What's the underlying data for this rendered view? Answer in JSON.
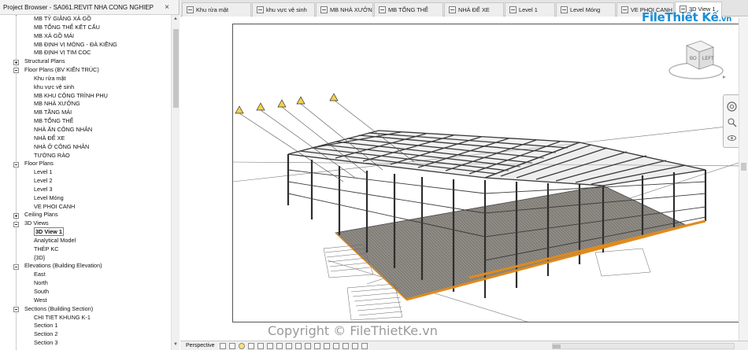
{
  "browser": {
    "title": "Project Browser - SA061.REVIT NHA CONG NGHIEP",
    "close": "×",
    "rows": [
      {
        "label": "MB TỶ GIẰNG XÀ GỒ",
        "level": 2
      },
      {
        "label": "MB TỔNG THỂ KẾT CẤU",
        "level": 2
      },
      {
        "label": "MB XÀ GỒ MÁI",
        "level": 2
      },
      {
        "label": "MB ĐỊNH VỊ MÓNG - ĐÀ KIỀNG",
        "level": 2
      },
      {
        "label": "MB ĐỊNH VỊ TIM COC",
        "level": 2
      },
      {
        "label": "Structural Plans",
        "level": 1,
        "toggle": "plus"
      },
      {
        "label": "Floor Plans (BV KIẾN TRÚC)",
        "level": 1,
        "toggle": "minus"
      },
      {
        "label": "Khu rửa mặt",
        "level": 2
      },
      {
        "label": "khu vực vệ sinh",
        "level": 2
      },
      {
        "label": "MB KHU CÔNG TRÌNH PHỤ",
        "level": 2
      },
      {
        "label": "MB NHÀ XƯỞNG",
        "level": 2
      },
      {
        "label": "MB TẦNG MÁI",
        "level": 2
      },
      {
        "label": "MB TỔNG THỂ",
        "level": 2
      },
      {
        "label": "NHÀ ĂN CÔNG NHÂN",
        "level": 2
      },
      {
        "label": "NHÀ ĐỂ XE",
        "level": 2
      },
      {
        "label": "NHÀ Ở CÔNG NHÂN",
        "level": 2
      },
      {
        "label": "TƯỜNG RÀO",
        "level": 2
      },
      {
        "label": "Floor Plans",
        "level": 1,
        "toggle": "minus"
      },
      {
        "label": "Level 1",
        "level": 2
      },
      {
        "label": "Level 2",
        "level": 2
      },
      {
        "label": "Level 3",
        "level": 2
      },
      {
        "label": "Level Móng",
        "level": 2
      },
      {
        "label": "VE PHOI CANH",
        "level": 2
      },
      {
        "label": "Ceiling Plans",
        "level": 1,
        "toggle": "plus"
      },
      {
        "label": "3D Views",
        "level": 1,
        "toggle": "minus"
      },
      {
        "label": "3D View 1",
        "level": 2,
        "selected": true
      },
      {
        "label": "Analytical Model",
        "level": 2
      },
      {
        "label": "THÉP KC",
        "level": 2
      },
      {
        "label": "{3D}",
        "level": 2
      },
      {
        "label": "Elevations (Building Elevation)",
        "level": 1,
        "toggle": "minus"
      },
      {
        "label": "East",
        "level": 2
      },
      {
        "label": "North",
        "level": 2
      },
      {
        "label": "South",
        "level": 2
      },
      {
        "label": "West",
        "level": 2
      },
      {
        "label": "Sections (Building Section)",
        "level": 1,
        "toggle": "minus"
      },
      {
        "label": "CHI TIET KHUNG K-1",
        "level": 2
      },
      {
        "label": "Section 1",
        "level": 2
      },
      {
        "label": "Section 2",
        "level": 2
      },
      {
        "label": "Section 3",
        "level": 2
      }
    ]
  },
  "tabs": [
    {
      "label": "Khu rửa mặt",
      "active": false
    },
    {
      "label": "khu vực vệ sinh",
      "active": false
    },
    {
      "label": "MB NHÀ XƯỞNG",
      "active": false
    },
    {
      "label": "MB TỔNG THỂ",
      "active": false
    },
    {
      "label": "NHÀ ĐỂ XE",
      "active": false
    },
    {
      "label": "Level 1",
      "active": false
    },
    {
      "label": "Level Móng",
      "active": false
    },
    {
      "label": "VE PHOI CANH",
      "active": false
    },
    {
      "label": "3D View 1",
      "active": true
    }
  ],
  "viewcube": {
    "face_front": "BO",
    "face_side": "LEFT"
  },
  "statusbar": {
    "view_style": "Perspective"
  },
  "watermark": {
    "logo_main": "File",
    "logo_accent": "Thiết Kế",
    "logo_domain": ".vn",
    "copyright": "Copyright © FileThietKe.vn"
  },
  "colors": {
    "accent": "#1a8fd8",
    "steel": "#3a3a3a",
    "slab": "#8e8a84",
    "edge_beam": "#e08a1e",
    "warning": "#f2d24a"
  }
}
